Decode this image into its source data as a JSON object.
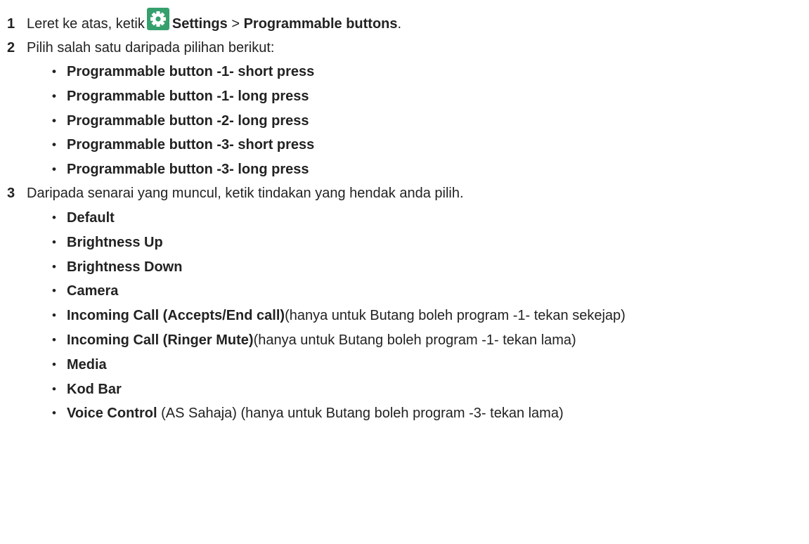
{
  "step1": {
    "number": "1",
    "text_before": "Leret ke atas, ketik",
    "settings_label": "Settings",
    "separator": ">",
    "menu_label": "Programmable buttons",
    "end": ".",
    "icon": "settings-gear-icon",
    "icon_color": "#35a06d"
  },
  "step2": {
    "number": "2",
    "text": "Pilih salah satu daripada pilihan berikut:",
    "options": [
      "Programmable button -1- short press",
      "Programmable button -1- long press",
      "Programmable button -2- long press",
      "Programmable button -3- short press",
      "Programmable button -3- long press"
    ]
  },
  "step3": {
    "number": "3",
    "text": "Daripada senarai yang muncul, ketik tindakan yang hendak anda pilih.",
    "actions": [
      {
        "label": "Default",
        "note": ""
      },
      {
        "label": "Brightness Up",
        "note": ""
      },
      {
        "label": "Brightness Down",
        "note": ""
      },
      {
        "label": "Camera",
        "note": ""
      },
      {
        "label": "Incoming Call (Accepts/End call)",
        "note": "(hanya untuk Butang boleh program -1- tekan sekejap)"
      },
      {
        "label": "Incoming Call (Ringer Mute)",
        "note": "(hanya untuk Butang boleh program -1- tekan lama)"
      },
      {
        "label": "Media",
        "note": ""
      },
      {
        "label": "Kod Bar",
        "note": ""
      },
      {
        "label": "Voice Control",
        "note": " (AS Sahaja) (hanya untuk Butang boleh program -3- tekan lama)"
      }
    ]
  }
}
